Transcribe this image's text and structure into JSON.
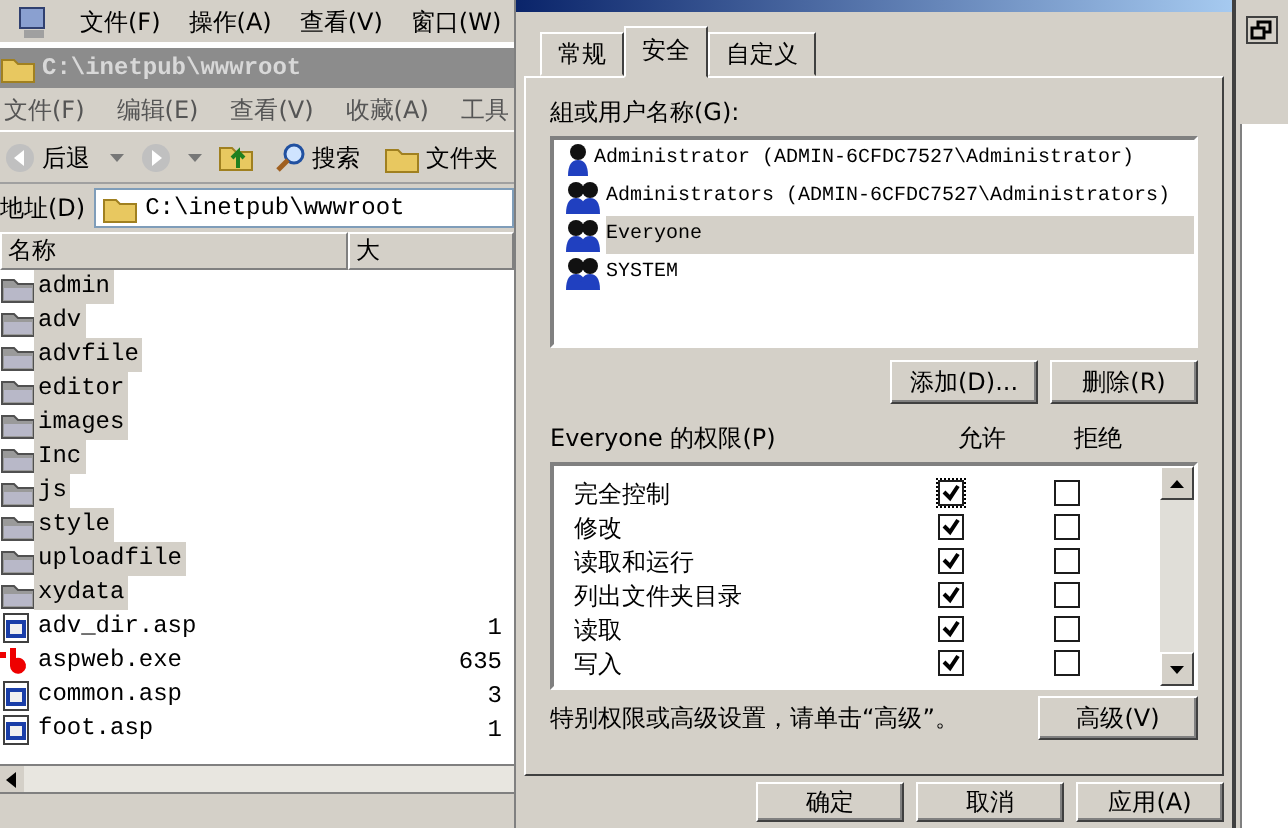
{
  "mmc_menu": [
    "文件(F)",
    "操作(A)",
    "查看(V)",
    "窗口(W)"
  ],
  "explorer": {
    "title": "C:\\inetpub\\wwwroot",
    "menu": [
      "文件(F)",
      "编辑(E)",
      "查看(V)",
      "收藏(A)",
      "工具"
    ],
    "toolbar": [
      {
        "kind": "back",
        "label": "后退"
      },
      {
        "kind": "search",
        "label": "搜索"
      },
      {
        "kind": "folders",
        "label": "文件夹"
      }
    ],
    "address": {
      "label": "地址(D)",
      "value": "C:\\inetpub\\wwwroot"
    },
    "columns": [
      "名称",
      "大"
    ],
    "rows": [
      {
        "kind": "folder",
        "name": "admin",
        "selected": true
      },
      {
        "kind": "folder",
        "name": "adv",
        "selected": true
      },
      {
        "kind": "folder",
        "name": "advfile",
        "selected": true
      },
      {
        "kind": "folder",
        "name": "editor",
        "selected": true
      },
      {
        "kind": "folder",
        "name": "images",
        "selected": true
      },
      {
        "kind": "folder",
        "name": "Inc",
        "selected": true
      },
      {
        "kind": "folder",
        "name": "js",
        "selected": true
      },
      {
        "kind": "folder",
        "name": "style",
        "selected": true
      },
      {
        "kind": "folder",
        "name": "uploadfile",
        "selected": true
      },
      {
        "kind": "folder",
        "name": "xydata",
        "selected": true
      },
      {
        "kind": "file",
        "name": "adv_dir.asp",
        "size": "1",
        "selected": false
      },
      {
        "kind": "exe",
        "name": "aspweb.exe",
        "size": "635",
        "selected": false
      },
      {
        "kind": "file",
        "name": "common.asp",
        "size": "3",
        "selected": false
      },
      {
        "kind": "file",
        "name": "foot.asp",
        "size": "1",
        "selected": false
      }
    ]
  },
  "dialog": {
    "tabs": [
      {
        "label": "常规",
        "selected": false
      },
      {
        "label": "安全",
        "selected": true
      },
      {
        "label": "自定义",
        "selected": false
      }
    ],
    "users_label": "組或用户名称(G):",
    "users": [
      {
        "kind": "user",
        "name": "Administrator (ADMIN-6CFDC7527\\Administrator)",
        "selected": false
      },
      {
        "kind": "group",
        "name": "Administrators (ADMIN-6CFDC7527\\Administrators)",
        "selected": false
      },
      {
        "kind": "group",
        "name": "Everyone",
        "selected": true
      },
      {
        "kind": "group",
        "name": "SYSTEM",
        "selected": false
      }
    ],
    "user_buttons": [
      "添加(D)...",
      "删除(R)"
    ],
    "perm_label": "Everyone 的权限(P)",
    "perm_columns": [
      "允许",
      "拒绝"
    ],
    "permissions": [
      {
        "name": "完全控制",
        "allow": true,
        "deny": false
      },
      {
        "name": "修改",
        "allow": true,
        "deny": false
      },
      {
        "name": "读取和运行",
        "allow": true,
        "deny": false
      },
      {
        "name": "列出文件夹目录",
        "allow": true,
        "deny": false
      },
      {
        "name": "读取",
        "allow": true,
        "deny": false
      },
      {
        "name": "写入",
        "allow": true,
        "deny": false
      }
    ],
    "advanced_note": "特别权限或高级设置，请单击“高级”。",
    "advanced_button": "高级(V)",
    "footer_buttons": [
      "确定",
      "取消",
      "应用(A)"
    ]
  }
}
